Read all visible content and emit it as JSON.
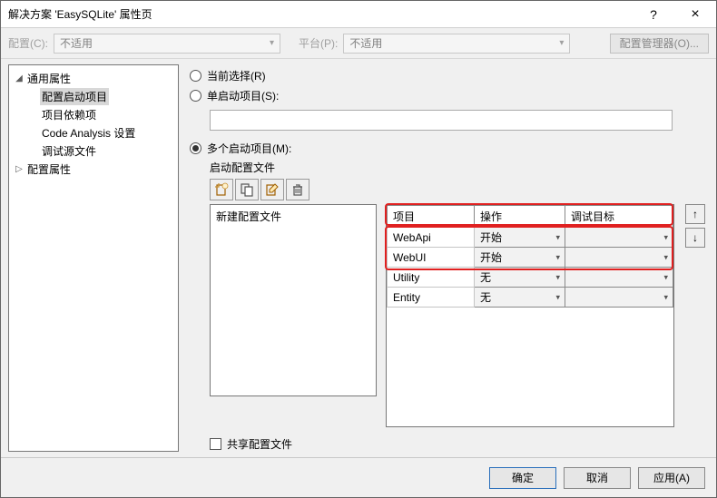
{
  "title": "解决方案 'EasySQLite' 属性页",
  "titlebar": {
    "help": "?",
    "close": "×"
  },
  "topstrip": {
    "config_label": "配置(C):",
    "config_value": "不适用",
    "platform_label": "平台(P):",
    "platform_value": "不适用",
    "config_manager": "配置管理器(O)..."
  },
  "tree": {
    "common": "通用属性",
    "items": [
      "配置启动项目",
      "项目依赖项",
      "Code Analysis 设置",
      "调试源文件"
    ],
    "config_props": "配置属性"
  },
  "radios": {
    "current": "当前选择(R)",
    "single": "单启动项目(S):",
    "multi": "多个启动项目(M):"
  },
  "profiles_label": "启动配置文件",
  "profiles_list_item": "新建配置文件",
  "grid": {
    "headers": [
      "项目",
      "操作",
      "调试目标"
    ],
    "rows": [
      {
        "project": "WebApi",
        "action": "开始",
        "target": ""
      },
      {
        "project": "WebUI",
        "action": "开始",
        "target": ""
      },
      {
        "project": "Utility",
        "action": "无",
        "target": ""
      },
      {
        "project": "Entity",
        "action": "无",
        "target": ""
      }
    ]
  },
  "arrows": {
    "up": "↑",
    "down": "↓"
  },
  "share_label": "共享配置文件",
  "footer": {
    "ok": "确定",
    "cancel": "取消",
    "apply": "应用(A)"
  }
}
